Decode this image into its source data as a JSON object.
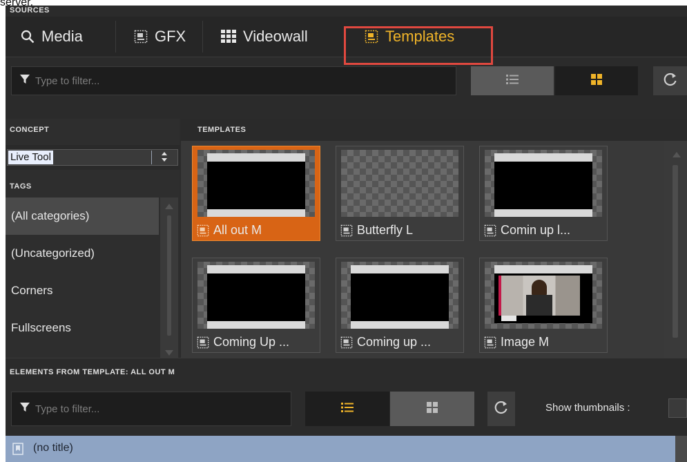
{
  "top_clip_text": "server.",
  "sources": {
    "header": "SOURCES",
    "tabs": [
      {
        "label": "Media",
        "icon": "search-icon"
      },
      {
        "label": "GFX",
        "icon": "template-icon"
      },
      {
        "label": "Videowall",
        "icon": "grid-icon"
      },
      {
        "label": "Templates",
        "icon": "template-icon",
        "active": true
      }
    ]
  },
  "top_filter": {
    "placeholder": "Type to filter..."
  },
  "concept": {
    "header": "CONCEPT",
    "selected": "Live Tool"
  },
  "tags": {
    "header": "TAGS",
    "items": [
      "(All categories)",
      "(Uncategorized)",
      "Corners",
      "Fullscreens"
    ],
    "selected_index": 0
  },
  "templates": {
    "header": "TEMPLATES",
    "items": [
      {
        "label": "All out M",
        "selected": true,
        "preview": "black-frame"
      },
      {
        "label": "Butterfly L",
        "selected": false,
        "preview": "checker"
      },
      {
        "label": "Comin up l...",
        "selected": false,
        "preview": "black-frame"
      },
      {
        "label": "Coming Up ...",
        "selected": false,
        "preview": "black-frame"
      },
      {
        "label": "Coming up ...",
        "selected": false,
        "preview": "black-frame"
      },
      {
        "label": "Image M",
        "selected": false,
        "preview": "image"
      }
    ]
  },
  "elements": {
    "header": "ELEMENTS FROM TEMPLATE: ALL OUT M",
    "filter_placeholder": "Type to filter...",
    "show_thumbnails_label": "Show thumbnails :",
    "first_row": "(no title)"
  },
  "colors": {
    "accent": "#f0b429",
    "selected_orange": "#d86415",
    "highlight_box": "#e0483f",
    "row_blue": "#8ea4c4"
  }
}
